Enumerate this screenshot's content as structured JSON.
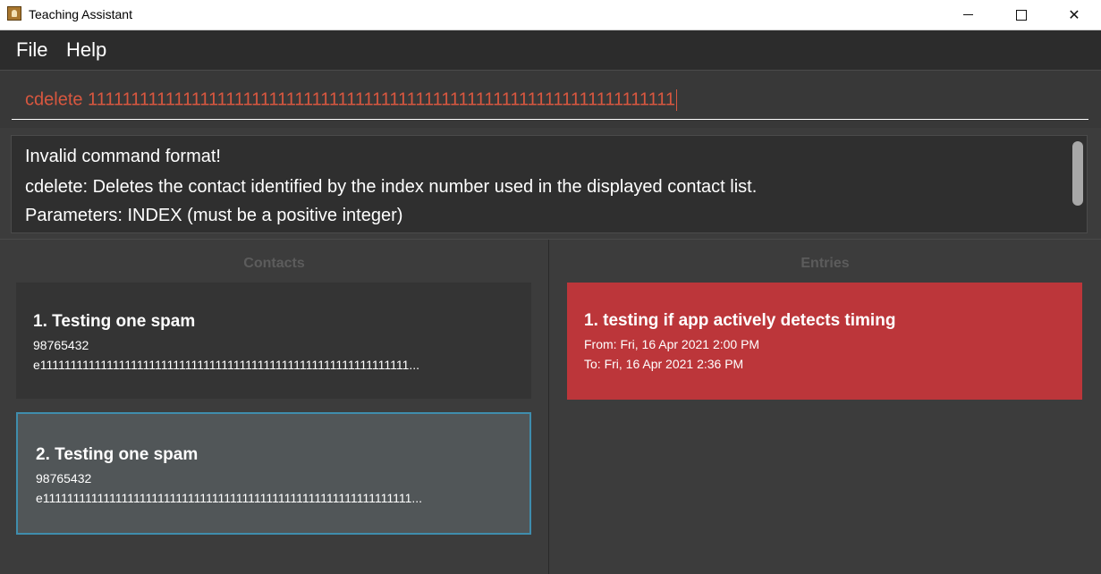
{
  "window": {
    "title": "Teaching Assistant",
    "controls": {
      "minimize": "—",
      "maximize": "☐",
      "close": "✕"
    }
  },
  "menu": {
    "file": "File",
    "help": "Help"
  },
  "command": {
    "value": "cdelete 11111111111111111111111111111111111111111111111111111111111111111111"
  },
  "result": {
    "line1": "Invalid command format!",
    "line2": "cdelete: Deletes the contact identified by the index number used in the displayed contact list.",
    "line3": "Parameters: INDEX (must be a positive integer)"
  },
  "contacts": {
    "title": "Contacts",
    "items": [
      {
        "heading": "1.  Testing one spam",
        "phone": "98765432",
        "email": "e1111111111111111111111111111111111111111111111111111111111111..."
      },
      {
        "heading": "2.  Testing one spam",
        "phone": "98765432",
        "email": "e1111111111111111111111111111111111111111111111111111111111111..."
      }
    ]
  },
  "entries": {
    "title": "Entries",
    "items": [
      {
        "heading": "1.  testing if app actively detects timing",
        "from": "From: Fri, 16 Apr 2021 2:00 PM",
        "to": "To: Fri, 16 Apr 2021 2:36 PM"
      }
    ]
  },
  "colors": {
    "background": "#3c3c3c",
    "command_text": "#d8573f",
    "selected_border": "#3f8dad",
    "entry_card": "#bc363a",
    "pane_title": "#5c5c5c"
  },
  "icons": {
    "app": "app-icon",
    "minimize": "minimize-icon",
    "maximize": "maximize-icon",
    "close": "close-icon"
  }
}
